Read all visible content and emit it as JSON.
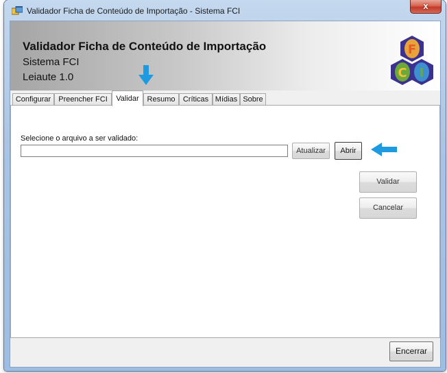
{
  "window": {
    "title": "Validador Ficha de Conteúdo de Importação - Sistema FCI",
    "close_label": "x"
  },
  "header": {
    "title": "Validador Ficha de Conteúdo de Importação",
    "subtitle": "Sistema FCI",
    "version": "Leiaute 1.0",
    "logo_letters": [
      "F",
      "C",
      "I"
    ]
  },
  "tabs": [
    {
      "label": "Configurar"
    },
    {
      "label": "Preencher FCI"
    },
    {
      "label": "Validar"
    },
    {
      "label": "Resumo"
    },
    {
      "label": "Críticas"
    },
    {
      "label": "Mídias"
    },
    {
      "label": "Sobre"
    }
  ],
  "active_tab": "Validar",
  "validar": {
    "file_label": "Selecione o arquivo a ser validado:",
    "file_value": "",
    "refresh_label": "Atualizar",
    "open_label": "Abrir",
    "validate_label": "Validar",
    "cancel_label": "Cancelar"
  },
  "footer": {
    "close_label": "Encerrar"
  },
  "colors": {
    "annotation_arrow": "#1e9be0",
    "logo_orange": "#e8a33a",
    "logo_green": "#6da83a",
    "logo_blue": "#3d8fd0",
    "logo_hex_bg": "#3a3190"
  },
  "icons": {
    "app": "app-window-icon",
    "annotation_down": "arrow-down-icon",
    "annotation_left": "arrow-left-icon"
  }
}
